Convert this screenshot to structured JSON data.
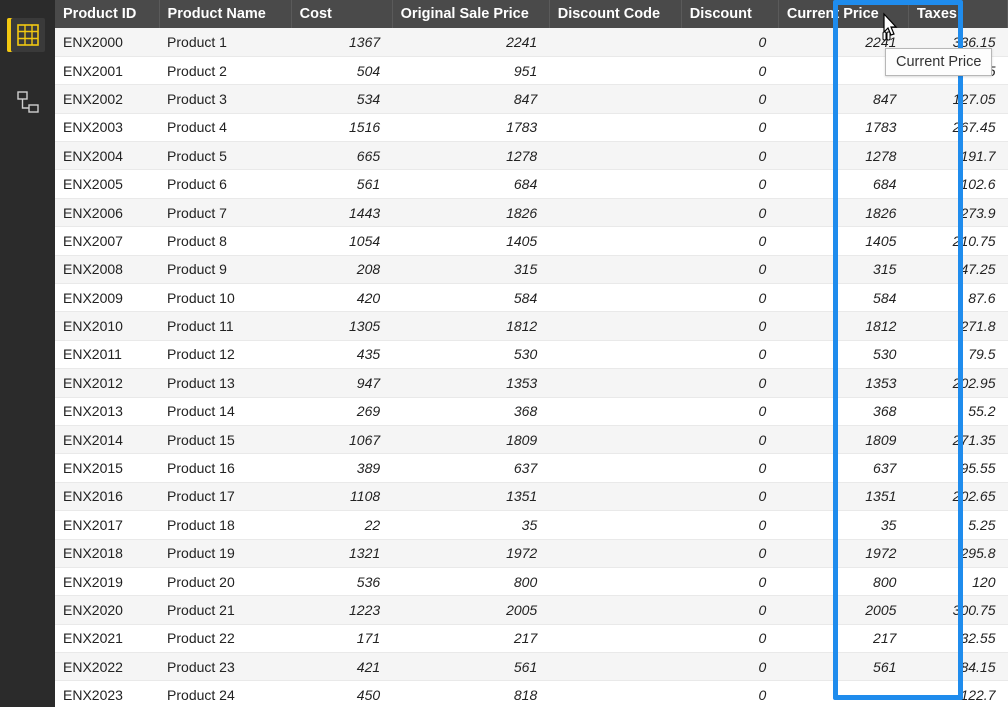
{
  "sidebar": {
    "icons": [
      "data-grid",
      "model-view"
    ]
  },
  "table": {
    "columns": [
      {
        "key": "id",
        "label": "Product ID",
        "type": "txt",
        "cls": "c-id"
      },
      {
        "key": "name",
        "label": "Product Name",
        "type": "txt",
        "cls": "c-name"
      },
      {
        "key": "cost",
        "label": "Cost",
        "type": "num",
        "cls": "c-cost"
      },
      {
        "key": "osp",
        "label": "Original Sale Price",
        "type": "num",
        "cls": "c-osp"
      },
      {
        "key": "dcode",
        "label": "Discount Code",
        "type": "txt",
        "cls": "c-dcode"
      },
      {
        "key": "disc",
        "label": "Discount",
        "type": "num",
        "cls": "c-disc"
      },
      {
        "key": "cur",
        "label": "Current Price",
        "type": "num",
        "cls": "c-cur"
      },
      {
        "key": "tax",
        "label": "Taxes",
        "type": "num",
        "cls": "c-tax"
      }
    ],
    "rows": [
      {
        "id": "ENX2000",
        "name": "Product 1",
        "cost": "1367",
        "osp": "2241",
        "dcode": "",
        "disc": "0",
        "cur": "2241",
        "tax": "336.15"
      },
      {
        "id": "ENX2001",
        "name": "Product 2",
        "cost": "504",
        "osp": "951",
        "dcode": "",
        "disc": "0",
        "cur": "",
        "tax": "142.65"
      },
      {
        "id": "ENX2002",
        "name": "Product 3",
        "cost": "534",
        "osp": "847",
        "dcode": "",
        "disc": "0",
        "cur": "847",
        "tax": "127.05"
      },
      {
        "id": "ENX2003",
        "name": "Product 4",
        "cost": "1516",
        "osp": "1783",
        "dcode": "",
        "disc": "0",
        "cur": "1783",
        "tax": "267.45"
      },
      {
        "id": "ENX2004",
        "name": "Product 5",
        "cost": "665",
        "osp": "1278",
        "dcode": "",
        "disc": "0",
        "cur": "1278",
        "tax": "191.7"
      },
      {
        "id": "ENX2005",
        "name": "Product 6",
        "cost": "561",
        "osp": "684",
        "dcode": "",
        "disc": "0",
        "cur": "684",
        "tax": "102.6"
      },
      {
        "id": "ENX2006",
        "name": "Product 7",
        "cost": "1443",
        "osp": "1826",
        "dcode": "",
        "disc": "0",
        "cur": "1826",
        "tax": "273.9"
      },
      {
        "id": "ENX2007",
        "name": "Product 8",
        "cost": "1054",
        "osp": "1405",
        "dcode": "",
        "disc": "0",
        "cur": "1405",
        "tax": "210.75"
      },
      {
        "id": "ENX2008",
        "name": "Product 9",
        "cost": "208",
        "osp": "315",
        "dcode": "",
        "disc": "0",
        "cur": "315",
        "tax": "47.25"
      },
      {
        "id": "ENX2009",
        "name": "Product 10",
        "cost": "420",
        "osp": "584",
        "dcode": "",
        "disc": "0",
        "cur": "584",
        "tax": "87.6"
      },
      {
        "id": "ENX2010",
        "name": "Product 11",
        "cost": "1305",
        "osp": "1812",
        "dcode": "",
        "disc": "0",
        "cur": "1812",
        "tax": "271.8"
      },
      {
        "id": "ENX2011",
        "name": "Product 12",
        "cost": "435",
        "osp": "530",
        "dcode": "",
        "disc": "0",
        "cur": "530",
        "tax": "79.5"
      },
      {
        "id": "ENX2012",
        "name": "Product 13",
        "cost": "947",
        "osp": "1353",
        "dcode": "",
        "disc": "0",
        "cur": "1353",
        "tax": "202.95"
      },
      {
        "id": "ENX2013",
        "name": "Product 14",
        "cost": "269",
        "osp": "368",
        "dcode": "",
        "disc": "0",
        "cur": "368",
        "tax": "55.2"
      },
      {
        "id": "ENX2014",
        "name": "Product 15",
        "cost": "1067",
        "osp": "1809",
        "dcode": "",
        "disc": "0",
        "cur": "1809",
        "tax": "271.35"
      },
      {
        "id": "ENX2015",
        "name": "Product 16",
        "cost": "389",
        "osp": "637",
        "dcode": "",
        "disc": "0",
        "cur": "637",
        "tax": "95.55"
      },
      {
        "id": "ENX2016",
        "name": "Product 17",
        "cost": "1108",
        "osp": "1351",
        "dcode": "",
        "disc": "0",
        "cur": "1351",
        "tax": "202.65"
      },
      {
        "id": "ENX2017",
        "name": "Product 18",
        "cost": "22",
        "osp": "35",
        "dcode": "",
        "disc": "0",
        "cur": "35",
        "tax": "5.25"
      },
      {
        "id": "ENX2018",
        "name": "Product 19",
        "cost": "1321",
        "osp": "1972",
        "dcode": "",
        "disc": "0",
        "cur": "1972",
        "tax": "295.8"
      },
      {
        "id": "ENX2019",
        "name": "Product 20",
        "cost": "536",
        "osp": "800",
        "dcode": "",
        "disc": "0",
        "cur": "800",
        "tax": "120"
      },
      {
        "id": "ENX2020",
        "name": "Product 21",
        "cost": "1223",
        "osp": "2005",
        "dcode": "",
        "disc": "0",
        "cur": "2005",
        "tax": "300.75"
      },
      {
        "id": "ENX2021",
        "name": "Product 22",
        "cost": "171",
        "osp": "217",
        "dcode": "",
        "disc": "0",
        "cur": "217",
        "tax": "32.55"
      },
      {
        "id": "ENX2022",
        "name": "Product 23",
        "cost": "421",
        "osp": "561",
        "dcode": "",
        "disc": "0",
        "cur": "561",
        "tax": "84.15"
      },
      {
        "id": "ENX2023",
        "name": "Product 24",
        "cost": "450",
        "osp": "818",
        "dcode": "",
        "disc": "0",
        "cur": "",
        "tax": "122.7"
      }
    ]
  },
  "tooltip": {
    "text": "Current Price"
  },
  "selectedColumn": "cur"
}
